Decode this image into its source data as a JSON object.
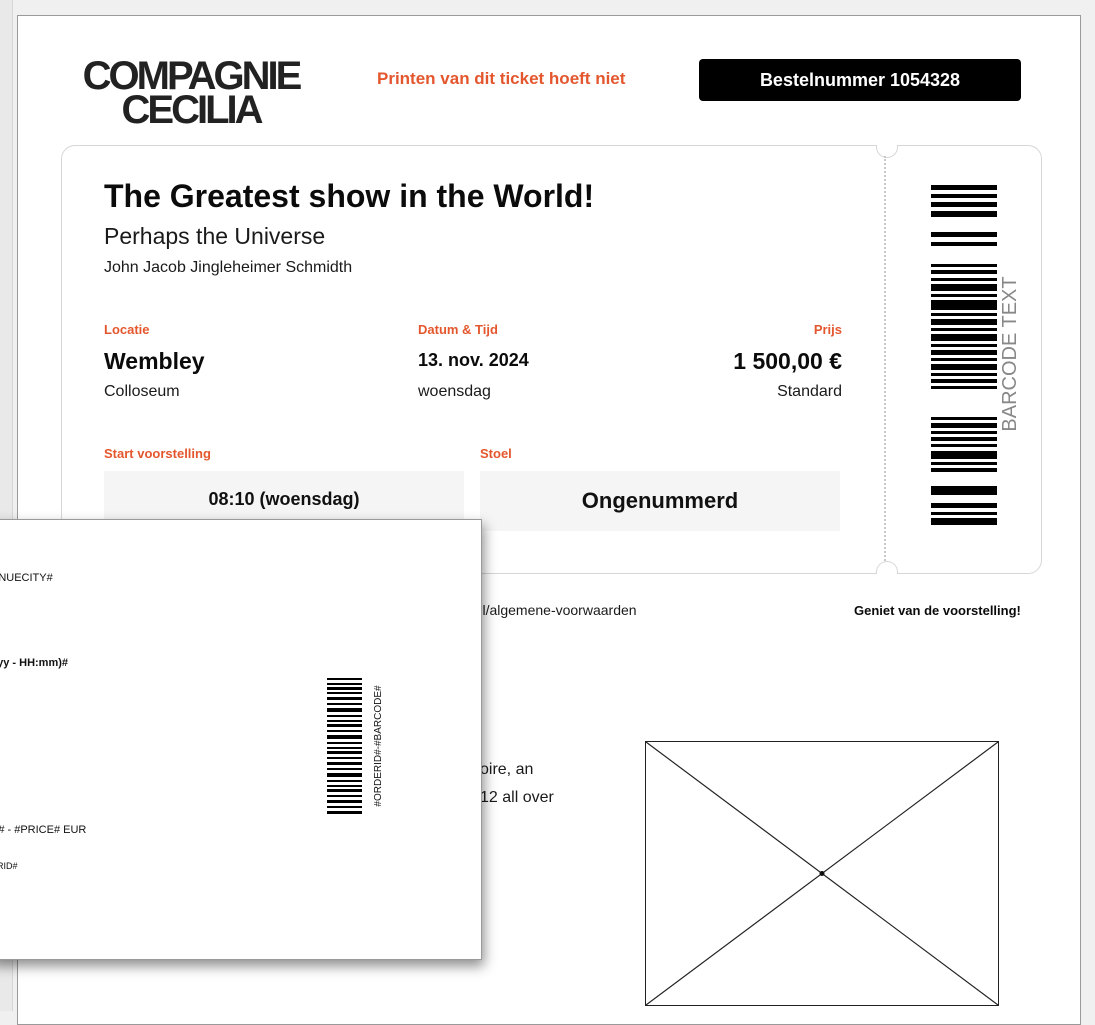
{
  "header": {
    "logo_line1": "COMPAGNIE",
    "logo_line2": "CECILIA",
    "notice": "Printen van dit ticket hoeft niet",
    "order_label": "Bestelnummer 1054328"
  },
  "ticket": {
    "title": "The Greatest show in the World!",
    "subtitle": "Perhaps the Universe",
    "performer": "John Jacob Jingleheimer Schmidth",
    "location": {
      "label": "Locatie",
      "venue": "Wembley",
      "city": "Colloseum"
    },
    "datetime": {
      "label": "Datum & Tijd",
      "date": "13. nov. 2024",
      "weekday": "woensdag"
    },
    "price": {
      "label": "Prijs",
      "amount": "1 500,00 €",
      "tier": "Standard"
    },
    "start": {
      "label": "Start voorstelling",
      "value": "08:10 (woensdag)"
    },
    "seat": {
      "label": "Stoel",
      "value": "Ongenummerd"
    },
    "barcode_text": "BARCODE TEXT"
  },
  "footer": {
    "terms_url": "e/nl/algemene-voorwaarden",
    "closing": "Geniet van de voorstelling!"
  },
  "body": {
    "line1": "oire, an",
    "line2": "12 all over"
  },
  "overlay": {
    "venue_city": "ENUECITY#",
    "datetime_format": "yyy - HH:mm)#",
    "price_line": "E# - #PRICE# EUR",
    "order_id": "ERID#",
    "barcode_text": "#ORDERID#-#BARCODE#"
  },
  "colors": {
    "accent": "#e4572e",
    "badge_bg": "#000000",
    "box_bg": "#f5f5f5"
  }
}
